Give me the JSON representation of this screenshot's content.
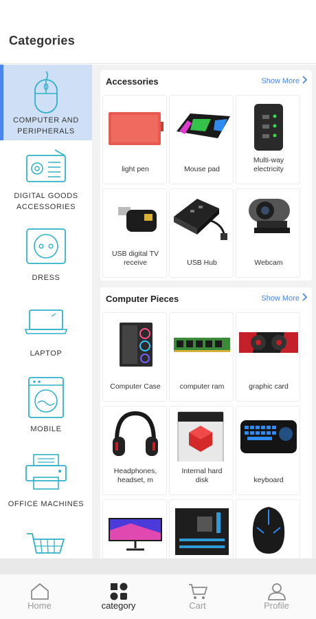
{
  "header": {
    "title": "Categories"
  },
  "sidebar": {
    "items": [
      {
        "label1": "COMPUTER AND",
        "label2": "PERIPHERALS",
        "icon": "mouse-icon",
        "active": true
      },
      {
        "label1": "DIGITAL GOODS",
        "label2": "ACCESSORIES",
        "icon": "radio-icon"
      },
      {
        "label1": "DRESS",
        "label2": "",
        "icon": "socket-icon"
      },
      {
        "label1": "LAPTOP",
        "label2": "",
        "icon": "laptop-icon"
      },
      {
        "label1": "MOBILE",
        "label2": "",
        "icon": "washing-machine-icon"
      },
      {
        "label1": "OFFICE MACHINES",
        "label2": "",
        "icon": "printer-icon"
      },
      {
        "label1": "",
        "label2": "",
        "icon": "shopping-cart-icon"
      }
    ]
  },
  "sections": [
    {
      "title": "Accessories",
      "show_more": "Show More",
      "items": [
        {
          "name1": "light pen",
          "name2": ""
        },
        {
          "name1": "Mouse pad",
          "name2": ""
        },
        {
          "name1": "Multi-way",
          "name2": "electricity"
        },
        {
          "name1": "USB digital TV",
          "name2": "receive"
        },
        {
          "name1": "USB Hub",
          "name2": ""
        },
        {
          "name1": "Webcam",
          "name2": ""
        }
      ]
    },
    {
      "title": "Computer Pieces",
      "show_more": "Show More",
      "items": [
        {
          "name1": "Computer Case",
          "name2": ""
        },
        {
          "name1": "computer ram",
          "name2": ""
        },
        {
          "name1": "graphic card",
          "name2": ""
        },
        {
          "name1": "Headphones,",
          "name2": "headset, m"
        },
        {
          "name1": "Internal hard",
          "name2": "disk"
        },
        {
          "name1": "keyboard",
          "name2": ""
        }
      ]
    }
  ],
  "tabs": [
    {
      "label": "Home",
      "icon": "home-icon"
    },
    {
      "label": "category",
      "icon": "category-icon",
      "active": true
    },
    {
      "label": "Cart",
      "icon": "cart-icon"
    },
    {
      "label": "Profile",
      "icon": "profile-icon"
    }
  ],
  "colors": {
    "accent": "#4a86e8",
    "icon_teal": "#2fb2c8",
    "active_bg": "#cfe0f6"
  }
}
